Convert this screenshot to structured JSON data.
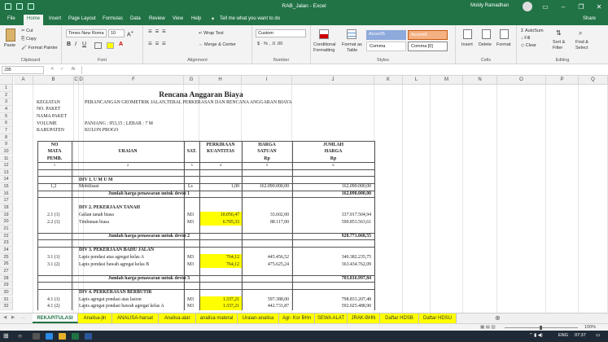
{
  "title_bar": {
    "doc_title": "RAB_Jalan - Excel",
    "user": "Moldy Ramadhan"
  },
  "menu": [
    "File",
    "Home",
    "Insert",
    "Page Layout",
    "Formulas",
    "Data",
    "Review",
    "View",
    "Help",
    "Tell me what you want to do",
    "Share"
  ],
  "ribbon": {
    "clipboard": {
      "label": "Clipboard",
      "paste": "Paste",
      "cut": "Cut",
      "copy": "Copy",
      "format_painter": "Format Painter"
    },
    "font": {
      "label": "Font",
      "font_name": "Times New Roma",
      "font_size": "10"
    },
    "alignment": {
      "label": "Alignment",
      "wrap": "Wrap Text",
      "merge": "Merge & Center"
    },
    "number": {
      "label": "Number",
      "format": "Custom"
    },
    "styles": {
      "label": "Styles",
      "cond": "Conditional",
      "cond2": "Formatting",
      "fmt_table": "Format as",
      "fmt_table2": "Table",
      "accent5": "Accent5",
      "accent6": "Accent6",
      "comma": "Comma",
      "comma0": "Comma [0]"
    },
    "cells": {
      "label": "Cells",
      "insert": "Insert",
      "delete": "Delete",
      "format": "Format"
    },
    "editing": {
      "label": "Editing",
      "autosum": "AutoSum",
      "fill": "Fill",
      "clear": "Clear",
      "sort": "Sort &",
      "sort2": "Filter",
      "find": "Find &",
      "find2": "Select"
    }
  },
  "formula_bar": {
    "name_box": "J35",
    "fx": "fx"
  },
  "columns": [
    "A",
    "B",
    "C",
    "D",
    "E",
    "F",
    "G",
    "H",
    "I",
    "J",
    "K",
    "L",
    "M",
    "N",
    "O",
    "P",
    "Q"
  ],
  "rows": [
    "1",
    "2",
    "3",
    "4",
    "5",
    "6",
    "7",
    "8",
    "9",
    "10",
    "11",
    "12",
    "13",
    "14",
    "15",
    "16",
    "17",
    "18",
    "19",
    "20",
    "21",
    "22",
    "23",
    "24",
    "25",
    "26",
    "27",
    "28",
    "29",
    "30",
    "31",
    "32"
  ],
  "sheet": {
    "title": "Rencana Anggaran Biaya",
    "info_labels": [
      "KEGIATAN",
      "NO. PAKET",
      "NAMA PAKET",
      "VOLUME",
      "KABUPATEN"
    ],
    "info_values": [
      "PERANCANGAN GEOMETRIK JALAN,TEBAL PERKERASAN DAN RENCANA ANGGARAN BIAYA",
      "",
      "",
      "PANJANG : 953,15 ; LEBAR : 7  M",
      "KULON PROGO"
    ],
    "headers": {
      "no1": "NO",
      "no2": "MATA",
      "no3": "PEMB.",
      "uraian": "URAIAN",
      "sat": "SAT.",
      "perk1": "PERKIRAAN",
      "perk2": "KUANTITAS",
      "harga1": "HARGA",
      "harga2": "SATUAN",
      "harga3": "Rp",
      "jumlah1": "JUMLAH",
      "jumlah2": "HARGA",
      "jumlah3": "Rp",
      "n1": "1",
      "n2": "2",
      "n3": "3",
      "n4": "4",
      "n5": "5",
      "n6": "6"
    },
    "div1": {
      "title": "DIV 1. U M U M",
      "no": "1,2",
      "item": "Mobilisasi",
      "sat": "Ls",
      "qty": "1,00",
      "price": "162.090.000,00",
      "total": "162.090.000,00",
      "sum_label": "Jumlah harga penawaran untuk devisi 1",
      "sum": "162.090.000,00"
    },
    "div2": {
      "title": "DIV 2.  PEKERJAAN TANAH",
      "rows": [
        {
          "no": "2.1 (1)",
          "item": "Galian tanah biasa",
          "sat": "M3",
          "qty": "10.056,47",
          "price": "33.602,00",
          "total": "337.917.504,94"
        },
        {
          "no": "2.2 (1)",
          "item": "Timbunan  biasa",
          "sat": "M3",
          "qty": "6.705,33",
          "price": "88.117,00",
          "total": "590.853.563,61"
        }
      ],
      "sum_label": "Jumlah harga penawaran untuk devisi 2",
      "sum": "928.771.068,55"
    },
    "div3": {
      "title": "DIV 3. PEKERJAAN BAHU JALAN",
      "rows": [
        {
          "no": "3.1 (1)",
          "item": "Lapis pondasi atas agregat kelas A",
          "sat": "M3",
          "qty": "764,12",
          "price": "445.456,52",
          "total": "340.382.235,75"
        },
        {
          "no": "3.1 (2)",
          "item": "Lapis pondasi bawah agregat kelas B",
          "sat": "M3",
          "qty": "764,12",
          "price": "475.625,24",
          "total": "363.434.762,09"
        }
      ],
      "sum_label": "Jumlah harga penawaran untuk devisi 3",
      "sum": "703.816.997,84"
    },
    "div4": {
      "title": "DIV 4.  PERKERASAN BERBUTIR",
      "rows": [
        {
          "no": "4.1 (1)",
          "item": "Lapis agregat pondasi atas lasion",
          "sat": "M3",
          "qty": "1.337,21",
          "price": "597.388,00",
          "total": "798.833.207,48"
        },
        {
          "no": "4.1 (2)",
          "item": "Lapis agregat pondasi bawah agregat kelas A",
          "sat": "M3",
          "qty": "1.337,21",
          "price": "442.731,87",
          "total": "592.025.488,90"
        }
      ]
    }
  },
  "tabs": [
    "REKAPITULASI",
    "Analisa-jln",
    "ANALISA-harsat",
    "Analisa-alat",
    "analisa materal",
    "Uraian-analisa",
    "Agr- Ksr BHn",
    "SEWA ALAT",
    "JRAK-BHN",
    "Daftar HDSB",
    "Daftar HDSU"
  ],
  "status": {
    "zoom": "100%"
  },
  "taskbar": {
    "lang": "ENG",
    "time": "07:37"
  },
  "colors": {
    "excel_green": "#217346",
    "highlight": "#ffff00",
    "taskbar": "#1f2a36"
  }
}
